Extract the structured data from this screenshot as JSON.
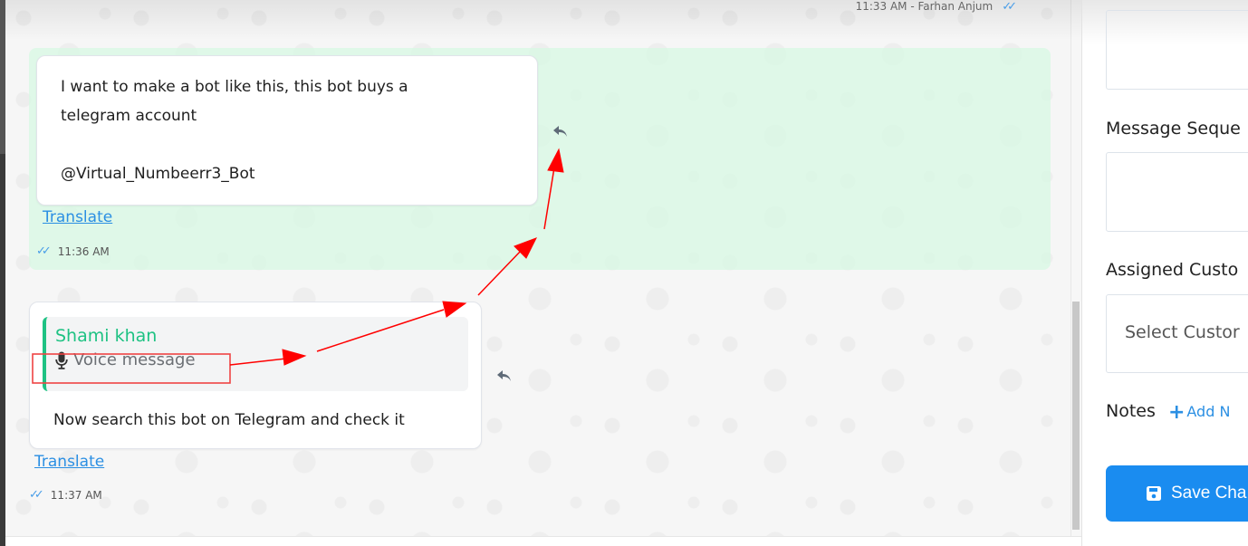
{
  "chat": {
    "top_meta": "11:33 AM - Farhan Anjum",
    "messages": [
      {
        "lines": [
          "I want to make a bot like this, this bot buys a",
          "telegram account",
          "",
          "@Virtual_Numbeerr3_Bot"
        ],
        "translate_label": "Translate",
        "time": "11:36 AM",
        "highlighted": true
      },
      {
        "reply_to": {
          "name": "Shami khan",
          "preview": "Voice message",
          "icon": "microphone-icon"
        },
        "body": "Now search this bot on Telegram and check it",
        "translate_label": "Translate",
        "time": "11:37 AM",
        "highlighted": false
      }
    ],
    "colors": {
      "highlight": "#d6fae2",
      "reply_accent": "#1ec283",
      "link": "#2b8fe3",
      "tick": "#4a9ee8"
    }
  },
  "right_panel": {
    "message_sequence_label": "Message Seque",
    "assigned_customer_label": "Assigned Custo",
    "assigned_customer_placeholder": "Select Custor",
    "notes_label": "Notes",
    "add_note_label": "Add N",
    "save_button_label": "Save Cha",
    "save_button_color": "#1a8cf0"
  },
  "annotation": {
    "color": "#ff0000",
    "description": "Red arrows from the 'Voice message' reply preview up to the reply icon of the previous message"
  }
}
